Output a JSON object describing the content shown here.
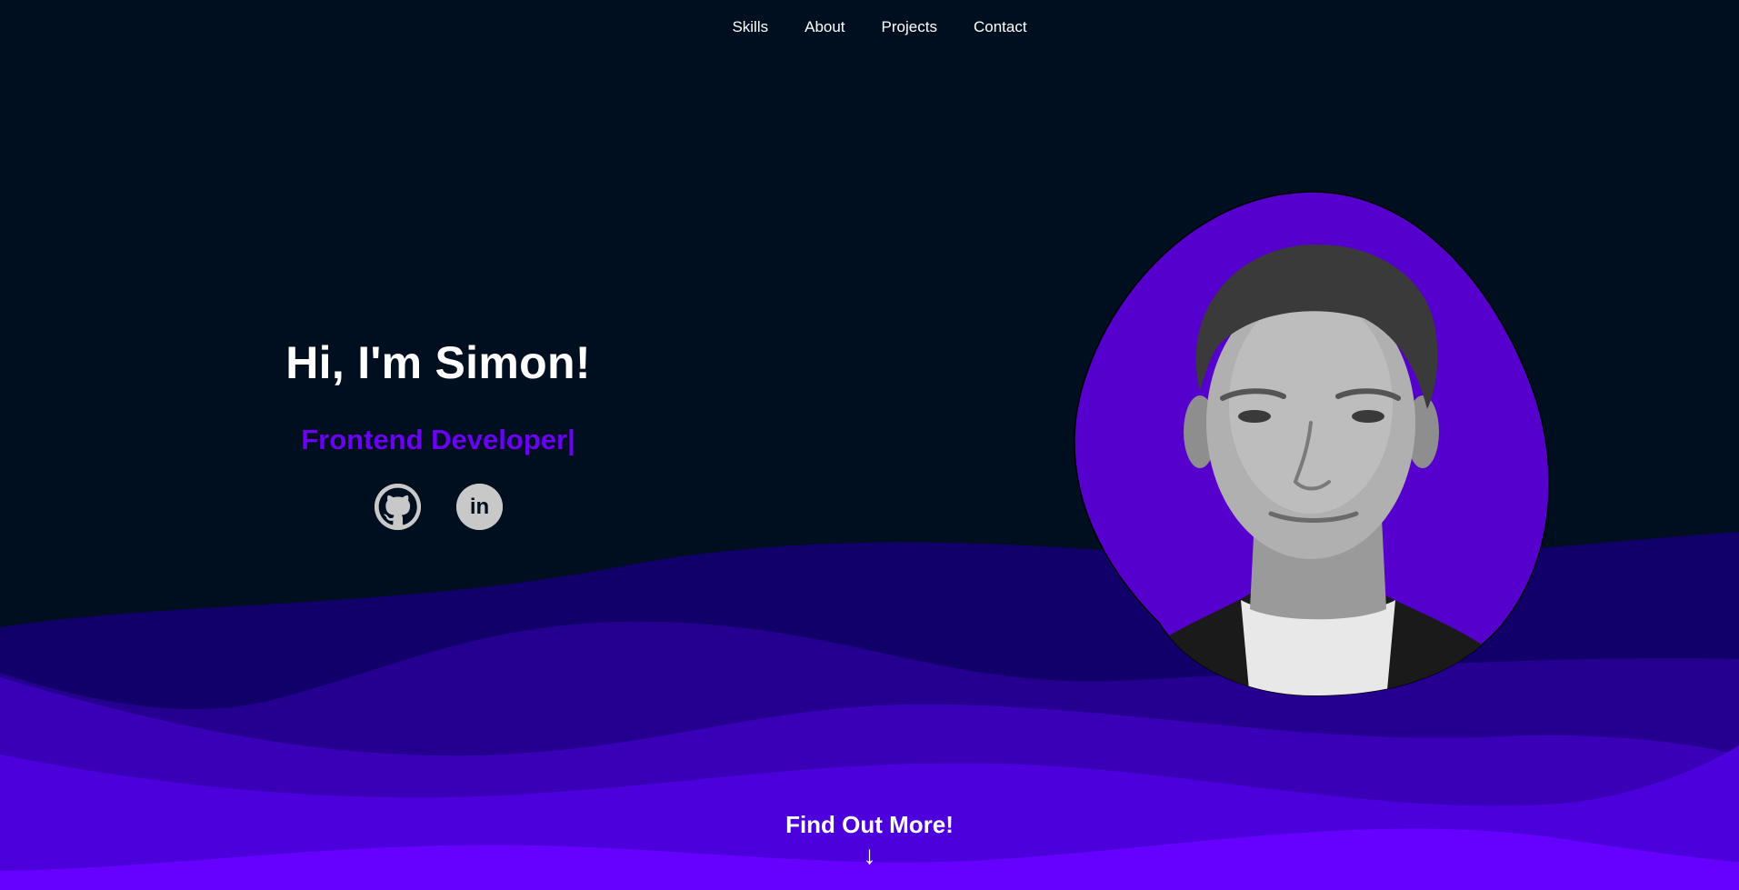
{
  "nav": {
    "items": [
      {
        "label": "Skills"
      },
      {
        "label": "About"
      },
      {
        "label": "Projects"
      },
      {
        "label": "Contact"
      }
    ]
  },
  "hero": {
    "title": "Hi, I'm Simon!",
    "subtitle": "Frontend Developer|"
  },
  "socials": [
    {
      "icon": "github-icon"
    },
    {
      "icon": "linkedin-icon",
      "text": "in"
    }
  ],
  "cta": {
    "label": "Find Out More!",
    "arrow": "↓"
  },
  "colors": {
    "background": "#000f1f",
    "accent": "#6a00f4",
    "blob": "#5500cc",
    "wave1": "#12006a",
    "wave2": "#250090",
    "wave3": "#3a00b8",
    "wave4": "#4c00dc",
    "wave5": "#6600ff",
    "icon_bg": "#c8c8c8"
  }
}
